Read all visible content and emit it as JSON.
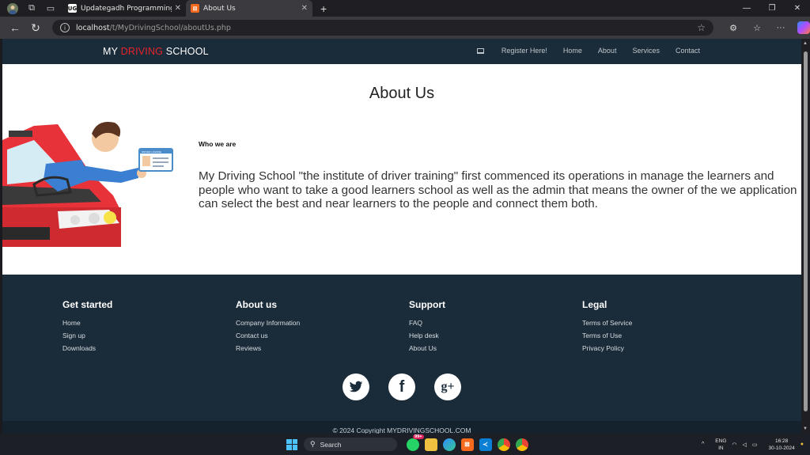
{
  "browser": {
    "tabs": [
      {
        "title": "Updategadh Programming - Upd",
        "favicon": "UG"
      },
      {
        "title": "About Us",
        "favicon": "XA"
      }
    ],
    "url_host": "localhost",
    "url_path": "/t/MyDrivingSchool/aboutUs.php"
  },
  "site": {
    "brand": {
      "part1": "MY ",
      "part2": "DRIVING",
      "part3": " SCHOOL"
    },
    "nav": {
      "register": "Register Here!",
      "home": "Home",
      "about": "About",
      "services": "Services",
      "contact": "Contact"
    },
    "page_title": "About Us",
    "who_heading": "Who we are",
    "description": "My Driving School \"the institute of driver training\" first commenced its operations in manage the learners and people who want to take a good learners school as well as the admin that means the owner of the we application can select the best and near learners to the people and connect them both.",
    "license_card_text": "DRIVER LICENSE"
  },
  "footer": {
    "columns": [
      {
        "title": "Get started",
        "links": [
          "Home",
          "Sign up",
          "Downloads"
        ]
      },
      {
        "title": "About us",
        "links": [
          "Company Information",
          "Contact us",
          "Reviews"
        ]
      },
      {
        "title": "Support",
        "links": [
          "FAQ",
          "Help desk",
          "About Us"
        ]
      },
      {
        "title": "Legal",
        "links": [
          "Terms of Service",
          "Terms of Use",
          "Privacy Policy"
        ]
      }
    ],
    "socials": [
      "twitter-icon",
      "facebook-icon",
      "google-plus-icon"
    ],
    "copyright": "© 2024 Copyright MYDRIVINGSCHOOL.COM"
  },
  "taskbar": {
    "search_label": "Search",
    "whatsapp_badge": "99+",
    "lang_line1": "ENG",
    "lang_line2": "IN",
    "time": "16:28",
    "date": "30-10-2024"
  },
  "colors": {
    "nav_bg": "#1a2b3a",
    "brand_red": "#e8232a",
    "car_red": "#e8323a"
  }
}
